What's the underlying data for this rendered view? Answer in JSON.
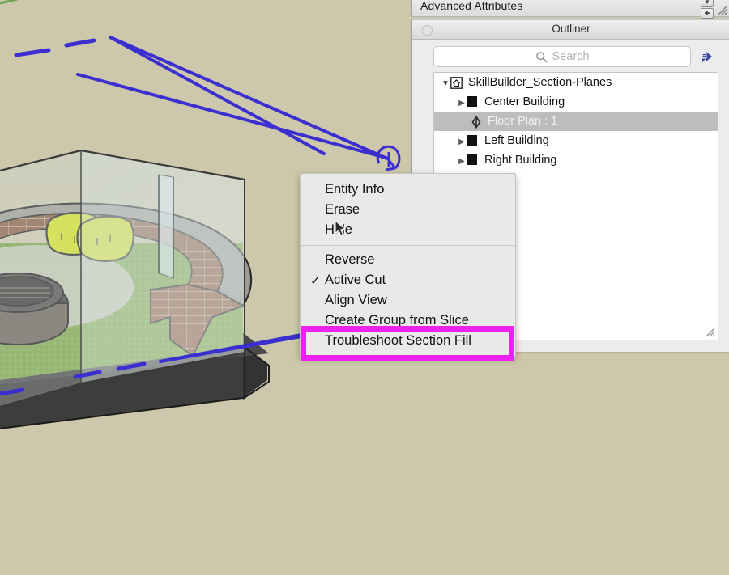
{
  "app": {
    "name": "SketchUp",
    "background_color": "#cdc8ab"
  },
  "panels": {
    "advanced_attributes": {
      "title": "Advanced Attributes",
      "collapse_icon": "chevron-down-icon",
      "expand_icon": "plus-icon",
      "resize_grip_icon": "resize-grip-icon"
    },
    "outliner": {
      "title": "Outliner",
      "disclosure_icon": "disclosure-circle-icon",
      "search": {
        "placeholder": "Search",
        "value": "",
        "icon": "search-icon"
      },
      "details_button": {
        "icon": "details-arrow-icon",
        "label": "",
        "color": "#3c4a9e"
      },
      "resize_grip_icon": "resize-grip-icon",
      "tree": [
        {
          "label": "SkillBuilder_Section-Planes",
          "indent": 1,
          "twisty": "down",
          "icon": "home-component-icon",
          "selected": false
        },
        {
          "label": "Center Building",
          "indent": 2,
          "twisty": "right",
          "icon": "group-black-icon",
          "selected": false
        },
        {
          "label": "Floor Plan : 1",
          "indent": 3,
          "twisty": "none",
          "icon": "section-plane-icon",
          "selected": true
        },
        {
          "label": "Left Building",
          "indent": 2,
          "twisty": "right",
          "icon": "group-black-icon",
          "selected": false
        },
        {
          "label": "Right Building",
          "indent": 2,
          "twisty": "right",
          "icon": "group-black-icon",
          "selected": false
        }
      ]
    }
  },
  "context_menu": {
    "items": [
      {
        "label": "Entity Info",
        "checked": false,
        "separator_after": false
      },
      {
        "label": "Erase",
        "checked": false,
        "separator_after": false
      },
      {
        "label": "Hide",
        "checked": false,
        "separator_after": true
      },
      {
        "label": "Reverse",
        "checked": false,
        "separator_after": false
      },
      {
        "label": "Active Cut",
        "checked": true,
        "separator_after": false
      },
      {
        "label": "Align View",
        "checked": false,
        "separator_after": false
      },
      {
        "label": "Create Group from Slice",
        "checked": false,
        "separator_after": false
      },
      {
        "label": "Troubleshoot Section Fill",
        "checked": false,
        "separator_after": false
      }
    ],
    "check_glyph": "✓",
    "highlight": {
      "target_label": "Troubleshoot Section Fill",
      "color": "#ee22ee"
    }
  },
  "viewport": {
    "description": "SketchUp 3D model of a courtyard with curved brick bench, fire pit and lawn, cut by an active section plane",
    "section_plane_color": "#3c2fd0",
    "ground_color": "#cdc8ab",
    "grass_color": "#7ea64a",
    "brick_color": "#8d5f44",
    "pillow_color": "#d4e029",
    "slab_color": "#3b3b3b",
    "glass_color": "#cfdde0",
    "section_grip_icon": "section-plane-grip-icon",
    "cursor_icon": "arrow-pointer-icon"
  }
}
